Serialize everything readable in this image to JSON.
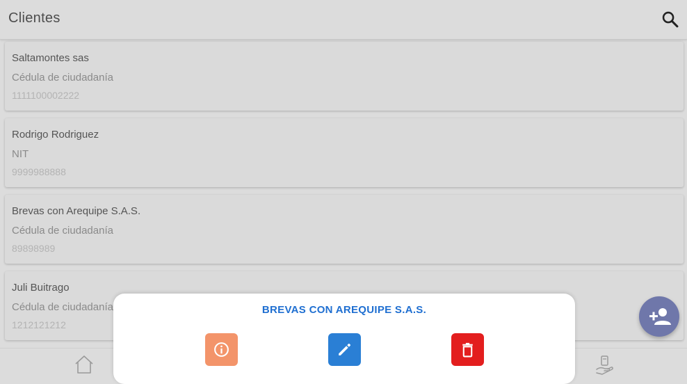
{
  "header": {
    "title": "Clientes",
    "search_icon": "search-icon"
  },
  "clients": [
    {
      "name": "Saltamontes sas",
      "doc_type": "Cédula de ciudadanía",
      "doc_number": "1111100002222"
    },
    {
      "name": "Rodrigo Rodriguez",
      "doc_type": "NIT",
      "doc_number": "9999988888"
    },
    {
      "name": "Brevas con Arequipe S.A.S.",
      "doc_type": "Cédula de ciudadanía",
      "doc_number": "89898989"
    },
    {
      "name": "Juli Buitrago",
      "doc_type": "Cédula de ciudadanía",
      "doc_number": "1212121212"
    }
  ],
  "fab": {
    "icon": "add-person-icon"
  },
  "bottom_nav": {
    "items": [
      "home-icon",
      "hand-payment-icon"
    ]
  },
  "action_sheet": {
    "title": "BREVAS CON AREQUIPE S.A.S.",
    "actions": [
      {
        "icon": "info-icon",
        "color": "#f3946a"
      },
      {
        "icon": "edit-icon",
        "color": "#2a7fd5"
      },
      {
        "icon": "delete-icon",
        "color": "#e31e1e"
      }
    ]
  }
}
